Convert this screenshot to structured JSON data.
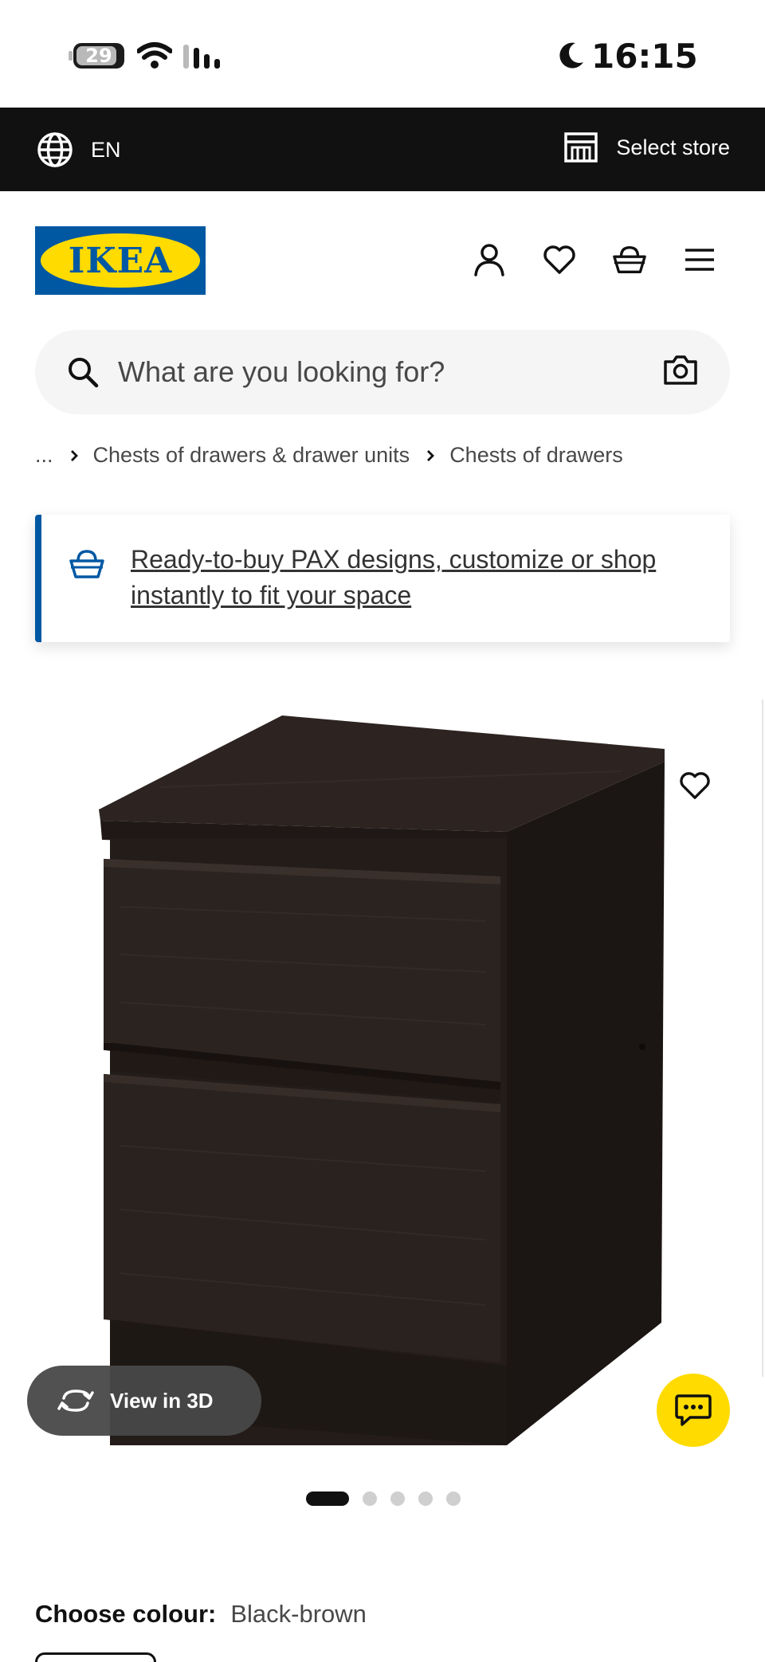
{
  "status_bar": {
    "battery_level": "29",
    "time": "16:15"
  },
  "topbar": {
    "language": "EN",
    "store_label": "Select store"
  },
  "header": {
    "logo_text": "IKEA",
    "icons": [
      "account-icon",
      "heart-icon",
      "basket-icon",
      "menu-icon"
    ]
  },
  "search": {
    "placeholder": "What are you looking for?"
  },
  "breadcrumb": {
    "items": [
      "...",
      "Chests of drawers & drawer units",
      "Chests of drawers"
    ]
  },
  "banner": {
    "text": "Ready-to-buy PAX designs, customize or shop instantly to fit your space"
  },
  "gallery": {
    "view3d_label": "View in 3D",
    "image_count": 5,
    "active_index": 0
  },
  "product": {
    "colour_label": "Choose colour:",
    "colour_value": "Black-brown"
  },
  "colors": {
    "brand_blue": "#0058a3",
    "brand_yellow": "#ffdb00",
    "topbar_bg": "#111111",
    "furniture": "#2b221f"
  }
}
